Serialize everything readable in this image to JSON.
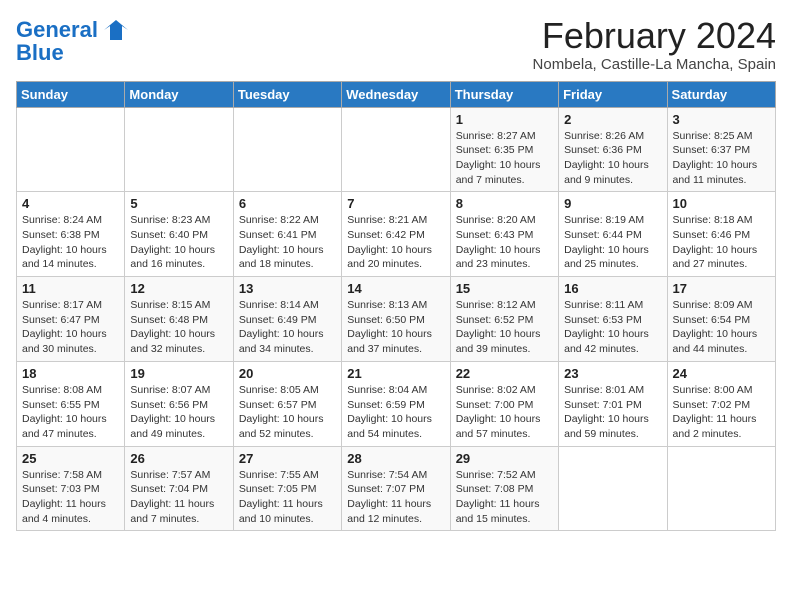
{
  "header": {
    "logo_line1": "General",
    "logo_line2": "Blue",
    "title": "February 2024",
    "subtitle": "Nombela, Castille-La Mancha, Spain"
  },
  "days_of_week": [
    "Sunday",
    "Monday",
    "Tuesday",
    "Wednesday",
    "Thursday",
    "Friday",
    "Saturday"
  ],
  "weeks": [
    [
      {
        "day": "",
        "info": ""
      },
      {
        "day": "",
        "info": ""
      },
      {
        "day": "",
        "info": ""
      },
      {
        "day": "",
        "info": ""
      },
      {
        "day": "1",
        "info": "Sunrise: 8:27 AM\nSunset: 6:35 PM\nDaylight: 10 hours\nand 7 minutes."
      },
      {
        "day": "2",
        "info": "Sunrise: 8:26 AM\nSunset: 6:36 PM\nDaylight: 10 hours\nand 9 minutes."
      },
      {
        "day": "3",
        "info": "Sunrise: 8:25 AM\nSunset: 6:37 PM\nDaylight: 10 hours\nand 11 minutes."
      }
    ],
    [
      {
        "day": "4",
        "info": "Sunrise: 8:24 AM\nSunset: 6:38 PM\nDaylight: 10 hours\nand 14 minutes."
      },
      {
        "day": "5",
        "info": "Sunrise: 8:23 AM\nSunset: 6:40 PM\nDaylight: 10 hours\nand 16 minutes."
      },
      {
        "day": "6",
        "info": "Sunrise: 8:22 AM\nSunset: 6:41 PM\nDaylight: 10 hours\nand 18 minutes."
      },
      {
        "day": "7",
        "info": "Sunrise: 8:21 AM\nSunset: 6:42 PM\nDaylight: 10 hours\nand 20 minutes."
      },
      {
        "day": "8",
        "info": "Sunrise: 8:20 AM\nSunset: 6:43 PM\nDaylight: 10 hours\nand 23 minutes."
      },
      {
        "day": "9",
        "info": "Sunrise: 8:19 AM\nSunset: 6:44 PM\nDaylight: 10 hours\nand 25 minutes."
      },
      {
        "day": "10",
        "info": "Sunrise: 8:18 AM\nSunset: 6:46 PM\nDaylight: 10 hours\nand 27 minutes."
      }
    ],
    [
      {
        "day": "11",
        "info": "Sunrise: 8:17 AM\nSunset: 6:47 PM\nDaylight: 10 hours\nand 30 minutes."
      },
      {
        "day": "12",
        "info": "Sunrise: 8:15 AM\nSunset: 6:48 PM\nDaylight: 10 hours\nand 32 minutes."
      },
      {
        "day": "13",
        "info": "Sunrise: 8:14 AM\nSunset: 6:49 PM\nDaylight: 10 hours\nand 34 minutes."
      },
      {
        "day": "14",
        "info": "Sunrise: 8:13 AM\nSunset: 6:50 PM\nDaylight: 10 hours\nand 37 minutes."
      },
      {
        "day": "15",
        "info": "Sunrise: 8:12 AM\nSunset: 6:52 PM\nDaylight: 10 hours\nand 39 minutes."
      },
      {
        "day": "16",
        "info": "Sunrise: 8:11 AM\nSunset: 6:53 PM\nDaylight: 10 hours\nand 42 minutes."
      },
      {
        "day": "17",
        "info": "Sunrise: 8:09 AM\nSunset: 6:54 PM\nDaylight: 10 hours\nand 44 minutes."
      }
    ],
    [
      {
        "day": "18",
        "info": "Sunrise: 8:08 AM\nSunset: 6:55 PM\nDaylight: 10 hours\nand 47 minutes."
      },
      {
        "day": "19",
        "info": "Sunrise: 8:07 AM\nSunset: 6:56 PM\nDaylight: 10 hours\nand 49 minutes."
      },
      {
        "day": "20",
        "info": "Sunrise: 8:05 AM\nSunset: 6:57 PM\nDaylight: 10 hours\nand 52 minutes."
      },
      {
        "day": "21",
        "info": "Sunrise: 8:04 AM\nSunset: 6:59 PM\nDaylight: 10 hours\nand 54 minutes."
      },
      {
        "day": "22",
        "info": "Sunrise: 8:02 AM\nSunset: 7:00 PM\nDaylight: 10 hours\nand 57 minutes."
      },
      {
        "day": "23",
        "info": "Sunrise: 8:01 AM\nSunset: 7:01 PM\nDaylight: 10 hours\nand 59 minutes."
      },
      {
        "day": "24",
        "info": "Sunrise: 8:00 AM\nSunset: 7:02 PM\nDaylight: 11 hours\nand 2 minutes."
      }
    ],
    [
      {
        "day": "25",
        "info": "Sunrise: 7:58 AM\nSunset: 7:03 PM\nDaylight: 11 hours\nand 4 minutes."
      },
      {
        "day": "26",
        "info": "Sunrise: 7:57 AM\nSunset: 7:04 PM\nDaylight: 11 hours\nand 7 minutes."
      },
      {
        "day": "27",
        "info": "Sunrise: 7:55 AM\nSunset: 7:05 PM\nDaylight: 11 hours\nand 10 minutes."
      },
      {
        "day": "28",
        "info": "Sunrise: 7:54 AM\nSunset: 7:07 PM\nDaylight: 11 hours\nand 12 minutes."
      },
      {
        "day": "29",
        "info": "Sunrise: 7:52 AM\nSunset: 7:08 PM\nDaylight: 11 hours\nand 15 minutes."
      },
      {
        "day": "",
        "info": ""
      },
      {
        "day": "",
        "info": ""
      }
    ]
  ]
}
